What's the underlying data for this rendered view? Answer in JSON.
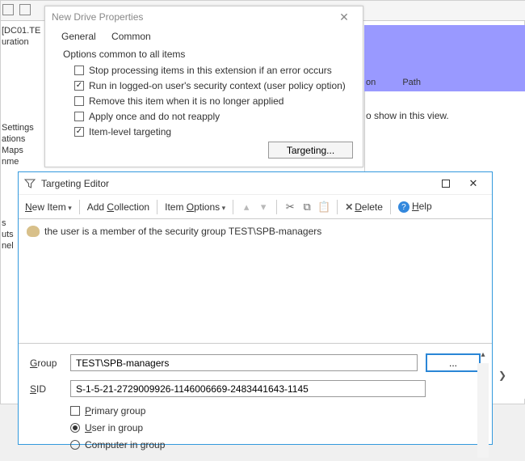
{
  "background": {
    "tree_item": "[DC01.TE",
    "tree_sub": "uration",
    "side_items": [
      "Settings",
      "ations",
      "Maps",
      "nme"
    ],
    "side_items2": [
      "s",
      "uts",
      "nel"
    ],
    "col_action": "on",
    "col_path": "Path",
    "empty_msg": "o show in this view."
  },
  "dlg1": {
    "title": "New Drive Properties",
    "tabs": {
      "general": "General",
      "common": "Common"
    },
    "header": "Options common to all items",
    "opts": [
      {
        "checked": false,
        "label": "Stop processing items in this extension if an error occurs"
      },
      {
        "checked": true,
        "label": "Run in logged-on user's security context (user policy option)"
      },
      {
        "checked": false,
        "label": "Remove this item when it is no longer applied"
      },
      {
        "checked": false,
        "label": "Apply once and do not reapply"
      },
      {
        "checked": true,
        "label": "Item-level targeting"
      }
    ],
    "targeting_btn": "Targeting..."
  },
  "dlg2": {
    "title": "Targeting Editor",
    "toolbar": {
      "new_item": "New Item",
      "add_collection": "Add Collection",
      "item_options": "Item Options",
      "delete": "Delete",
      "help": "Help"
    },
    "rule_prefix": "the user is a member of the security group ",
    "rule_group": "TEST\\SPB-managers",
    "form": {
      "group_label": "Group",
      "group_value": "TEST\\SPB-managers",
      "sid_label": "SID",
      "sid_value": "S-1-5-21-2729009926-1146006669-2483441643-1145",
      "browse": "...",
      "primary_group": "Primary group",
      "user_in_group": "User in group",
      "computer_in_group": "Computer in group"
    }
  }
}
